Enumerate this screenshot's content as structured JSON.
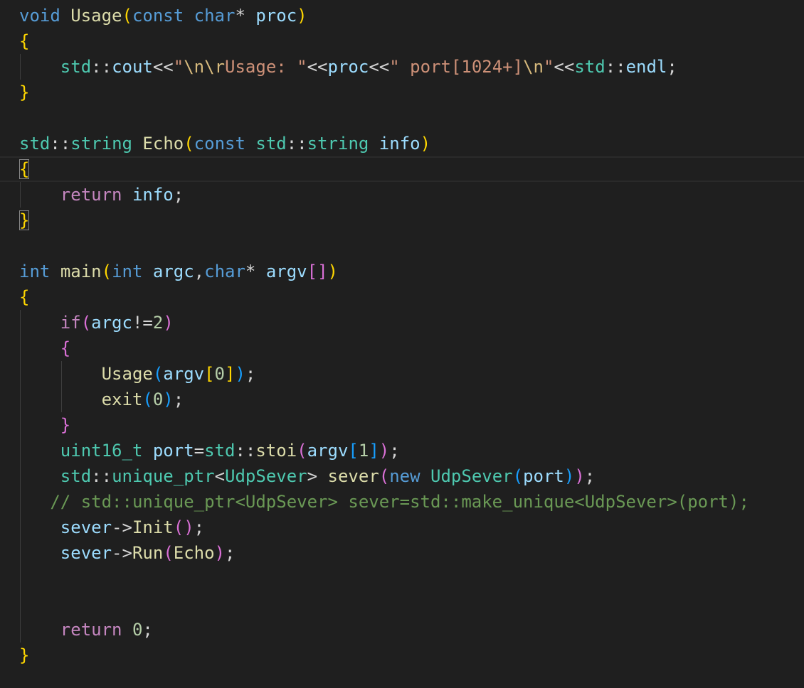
{
  "colors": {
    "background": "#1f1f1f",
    "default": "#d4d4d4",
    "keyword": "#569cd6",
    "control": "#c586c0",
    "function": "#dcdcaa",
    "variable": "#9cdcfe",
    "type": "#4ec9b0",
    "string": "#ce9178",
    "escape": "#d7ba7d",
    "number": "#b5cea8",
    "comment": "#6a9955",
    "bracket1": "#ffd700",
    "bracket2": "#da70d6",
    "bracket3": "#179fff"
  },
  "code_lines": [
    [
      [
        "void",
        "keyword"
      ],
      [
        " ",
        "default"
      ],
      [
        "Usage",
        "function"
      ],
      [
        "(",
        "bracket1"
      ],
      [
        "const",
        "keyword"
      ],
      [
        " ",
        "default"
      ],
      [
        "char",
        "keyword"
      ],
      [
        "*",
        "default"
      ],
      [
        " ",
        "default"
      ],
      [
        "proc",
        "variable"
      ],
      [
        ")",
        "bracket1"
      ]
    ],
    [
      [
        "{",
        "bracket1"
      ]
    ],
    [
      [
        "    ",
        "default"
      ],
      [
        "std",
        "type"
      ],
      [
        "::",
        "default"
      ],
      [
        "cout",
        "variable"
      ],
      [
        "<<",
        "default"
      ],
      [
        "\"",
        "string"
      ],
      [
        "\\n\\r",
        "escape"
      ],
      [
        "Usage: \"",
        "string"
      ],
      [
        "<<",
        "default"
      ],
      [
        "proc",
        "variable"
      ],
      [
        "<<",
        "default"
      ],
      [
        "\" port[1024+]",
        "string"
      ],
      [
        "\\n",
        "escape"
      ],
      [
        "\"",
        "string"
      ],
      [
        "<<",
        "default"
      ],
      [
        "std",
        "type"
      ],
      [
        "::",
        "default"
      ],
      [
        "endl",
        "variable"
      ],
      [
        ";",
        "default"
      ]
    ],
    [
      [
        "}",
        "bracket1"
      ]
    ],
    [],
    [
      [
        "std",
        "type"
      ],
      [
        "::",
        "default"
      ],
      [
        "string",
        "type"
      ],
      [
        " ",
        "default"
      ],
      [
        "Echo",
        "function"
      ],
      [
        "(",
        "bracket1"
      ],
      [
        "const",
        "keyword"
      ],
      [
        " ",
        "default"
      ],
      [
        "std",
        "type"
      ],
      [
        "::",
        "default"
      ],
      [
        "string",
        "type"
      ],
      [
        " ",
        "default"
      ],
      [
        "info",
        "variable"
      ],
      [
        ")",
        "bracket1"
      ]
    ],
    [
      [
        "{",
        "bracket1-box"
      ]
    ],
    [
      [
        "    ",
        "default"
      ],
      [
        "return",
        "control"
      ],
      [
        " ",
        "default"
      ],
      [
        "info",
        "variable"
      ],
      [
        ";",
        "default"
      ]
    ],
    [
      [
        "}",
        "bracket1-box"
      ]
    ],
    [],
    [
      [
        "int",
        "keyword"
      ],
      [
        " ",
        "default"
      ],
      [
        "main",
        "function"
      ],
      [
        "(",
        "bracket1"
      ],
      [
        "int",
        "keyword"
      ],
      [
        " ",
        "default"
      ],
      [
        "argc",
        "variable"
      ],
      [
        ",",
        "default"
      ],
      [
        "char",
        "keyword"
      ],
      [
        "*",
        "default"
      ],
      [
        " ",
        "default"
      ],
      [
        "argv",
        "variable"
      ],
      [
        "[]",
        "bracket2"
      ],
      [
        ")",
        "bracket1"
      ]
    ],
    [
      [
        "{",
        "bracket1"
      ]
    ],
    [
      [
        "    ",
        "default"
      ],
      [
        "if",
        "control"
      ],
      [
        "(",
        "bracket2"
      ],
      [
        "argc",
        "variable"
      ],
      [
        "!=",
        "default"
      ],
      [
        "2",
        "number"
      ],
      [
        ")",
        "bracket2"
      ]
    ],
    [
      [
        "    ",
        "default"
      ],
      [
        "{",
        "bracket2"
      ]
    ],
    [
      [
        "        ",
        "default"
      ],
      [
        "Usage",
        "function"
      ],
      [
        "(",
        "bracket3"
      ],
      [
        "argv",
        "variable"
      ],
      [
        "[",
        "bracket1"
      ],
      [
        "0",
        "number"
      ],
      [
        "]",
        "bracket1"
      ],
      [
        ")",
        "bracket3"
      ],
      [
        ";",
        "default"
      ]
    ],
    [
      [
        "        ",
        "default"
      ],
      [
        "exit",
        "function"
      ],
      [
        "(",
        "bracket3"
      ],
      [
        "0",
        "number"
      ],
      [
        ")",
        "bracket3"
      ],
      [
        ";",
        "default"
      ]
    ],
    [
      [
        "    ",
        "default"
      ],
      [
        "}",
        "bracket2"
      ]
    ],
    [
      [
        "    ",
        "default"
      ],
      [
        "uint16_t",
        "type"
      ],
      [
        " ",
        "default"
      ],
      [
        "port",
        "variable"
      ],
      [
        "=",
        "default"
      ],
      [
        "std",
        "type"
      ],
      [
        "::",
        "default"
      ],
      [
        "stoi",
        "function"
      ],
      [
        "(",
        "bracket2"
      ],
      [
        "argv",
        "variable"
      ],
      [
        "[",
        "bracket3"
      ],
      [
        "1",
        "number"
      ],
      [
        "]",
        "bracket3"
      ],
      [
        ")",
        "bracket2"
      ],
      [
        ";",
        "default"
      ]
    ],
    [
      [
        "    ",
        "default"
      ],
      [
        "std",
        "type"
      ],
      [
        "::",
        "default"
      ],
      [
        "unique_ptr",
        "type"
      ],
      [
        "<",
        "default"
      ],
      [
        "UdpSever",
        "type"
      ],
      [
        "> ",
        "default"
      ],
      [
        "sever",
        "function"
      ],
      [
        "(",
        "bracket2"
      ],
      [
        "new",
        "keyword"
      ],
      [
        " ",
        "default"
      ],
      [
        "UdpSever",
        "type"
      ],
      [
        "(",
        "bracket3"
      ],
      [
        "port",
        "variable"
      ],
      [
        ")",
        "bracket3"
      ],
      [
        ")",
        "bracket2"
      ],
      [
        ";",
        "default"
      ]
    ],
    [
      [
        "   ",
        "default"
      ],
      [
        "// std::unique_ptr<UdpSever> sever=std::make_unique<UdpSever>(port);",
        "comment"
      ]
    ],
    [
      [
        "    ",
        "default"
      ],
      [
        "sever",
        "variable"
      ],
      [
        "->",
        "default"
      ],
      [
        "Init",
        "function"
      ],
      [
        "(",
        "bracket2"
      ],
      [
        ")",
        "bracket2"
      ],
      [
        ";",
        "default"
      ]
    ],
    [
      [
        "    ",
        "default"
      ],
      [
        "sever",
        "variable"
      ],
      [
        "->",
        "default"
      ],
      [
        "Run",
        "function"
      ],
      [
        "(",
        "bracket2"
      ],
      [
        "Echo",
        "function"
      ],
      [
        ")",
        "bracket2"
      ],
      [
        ";",
        "default"
      ]
    ],
    [],
    [],
    [
      [
        "    ",
        "default"
      ],
      [
        "return",
        "control"
      ],
      [
        " ",
        "default"
      ],
      [
        "0",
        "number"
      ],
      [
        ";",
        "default"
      ]
    ],
    [
      [
        "}",
        "bracket1"
      ]
    ]
  ]
}
